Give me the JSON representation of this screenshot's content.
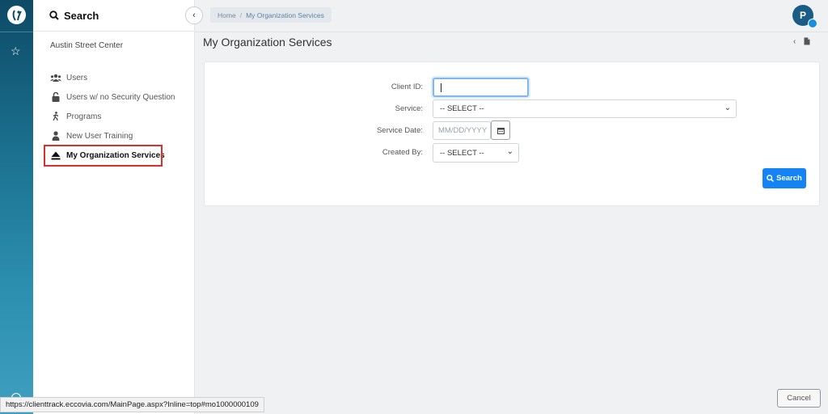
{
  "sidebar": {
    "title": "Search",
    "org_name": "Austin Street Center",
    "items": [
      {
        "label": "Users",
        "icon": "users-icon"
      },
      {
        "label": "Users w/ no Security Question",
        "icon": "unlock-icon"
      },
      {
        "label": "Programs",
        "icon": "person-walking-icon"
      },
      {
        "label": "New User Training",
        "icon": "user-icon"
      },
      {
        "label": "My Organization Services",
        "icon": "eject-icon"
      }
    ]
  },
  "breadcrumb": {
    "home": "Home",
    "separator": "/",
    "current": "My Organization Services"
  },
  "user": {
    "initial": "P"
  },
  "page": {
    "title": "My Organization Services"
  },
  "form": {
    "client_id": {
      "label": "Client ID:",
      "value": ""
    },
    "service": {
      "label": "Service:",
      "value": "-- SELECT --"
    },
    "service_date": {
      "label": "Service Date:",
      "placeholder": "MM/DD/YYYY"
    },
    "created_by": {
      "label": "Created By:",
      "value": "-- SELECT --"
    },
    "search_label": "Search"
  },
  "footer": {
    "cancel_label": "Cancel",
    "status_url": "https://clienttrack.eccovia.com/MainPage.aspx?Inline=top#mo1000000109"
  },
  "colors": {
    "primary": "#1483f5",
    "highlight": "#d9302c",
    "avatar": "#1a5c85"
  }
}
